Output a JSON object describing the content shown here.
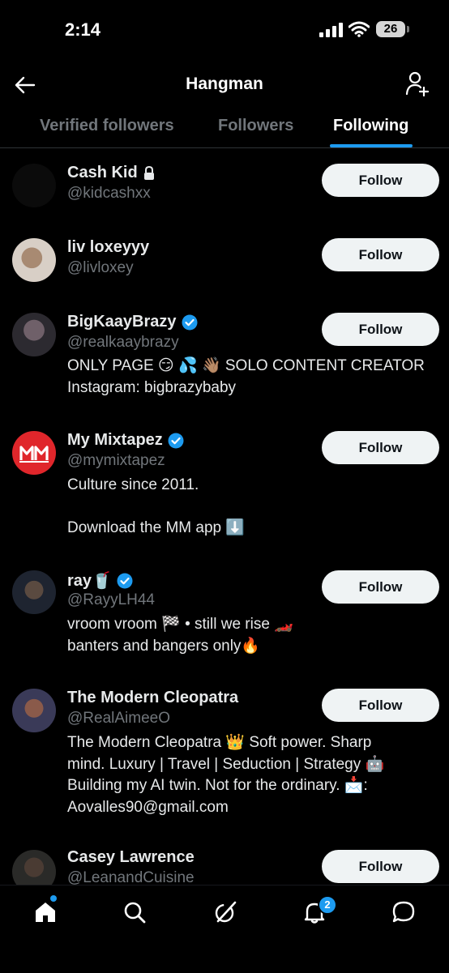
{
  "status": {
    "time": "2:14",
    "battery": "26"
  },
  "header": {
    "title": "Hangman"
  },
  "tabs": [
    {
      "label": "Verified followers"
    },
    {
      "label": "Followers"
    },
    {
      "label": "Following"
    }
  ],
  "users": [
    {
      "name": "Cash Kid",
      "handle": "@kidcashxx",
      "bio": "",
      "button": "Follow"
    },
    {
      "name": "liv loxeyyy",
      "handle": "@livloxey",
      "bio": "",
      "button": "Follow"
    },
    {
      "name": "BigKaayBrazy",
      "handle": "@realkaaybrazy",
      "bio": "ONLY PAGE 😏 💦 👋🏽 SOLO CONTENT CREATOR\nInstagram: bigbrazybaby",
      "button": "Follow"
    },
    {
      "name": "My Mixtapez",
      "handle": "@mymixtapez",
      "bio": "Culture since 2011.\n\nDownload the MM app ⬇️",
      "button": "Follow"
    },
    {
      "name": "ray🥤",
      "handle": "@RayyLH44",
      "bio": "vroom vroom 🏁 • still we rise 🏎️\nbanters and bangers only🔥",
      "button": "Follow"
    },
    {
      "name": "The Modern Cleopatra",
      "handle": "@RealAimeeO",
      "bio": "The Modern Cleopatra 👑 Soft power. Sharp\nmind. Luxury | Travel | Seduction | Strategy 🤖\nBuilding my AI twin. Not for the ordinary. 📩:\nAovalles90@gmail.com",
      "button": "Follow"
    },
    {
      "name": "Casey Lawrence",
      "handle": "@LeanandCuisine",
      "bio": "",
      "button": "Follow"
    }
  ],
  "nav": {
    "notifications_badge": "2"
  },
  "colors": {
    "accent": "#1d9bf0",
    "background": "#000000",
    "muted": "#71767b"
  }
}
